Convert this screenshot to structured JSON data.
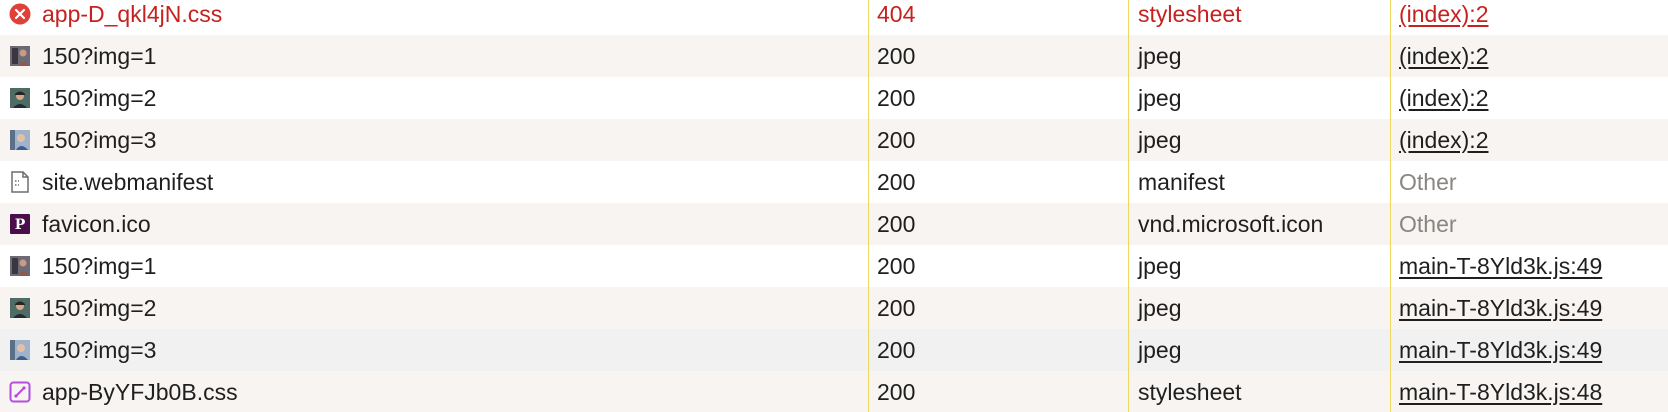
{
  "colors": {
    "error": "#c5221f",
    "divider": "#f0d860",
    "row_alt": "#f7f4f2",
    "row_hover": "#f1f1f2",
    "muted": "#8a8580",
    "css_icon": "#b44ce0",
    "favicon_bg": "#4a0f4a"
  },
  "rows": [
    {
      "icon": "error-circle-icon",
      "name": "app-D_qkl4jN.css",
      "status": "404",
      "type": "stylesheet",
      "initiator": "(index):2",
      "initiator_link": true,
      "error": true
    },
    {
      "icon": "image-thumbnail-icon",
      "name": "150?img=1",
      "status": "200",
      "type": "jpeg",
      "initiator": "(index):2",
      "initiator_link": true
    },
    {
      "icon": "image-thumbnail-icon",
      "name": "150?img=2",
      "status": "200",
      "type": "jpeg",
      "initiator": "(index):2",
      "initiator_link": true
    },
    {
      "icon": "image-thumbnail-icon",
      "name": "150?img=3",
      "status": "200",
      "type": "jpeg",
      "initiator": "(index):2",
      "initiator_link": true
    },
    {
      "icon": "document-icon",
      "name": "site.webmanifest",
      "status": "200",
      "type": "manifest",
      "initiator": "Other",
      "initiator_link": false
    },
    {
      "icon": "favicon-p-icon",
      "favicon_letter": "P",
      "name": "favicon.ico",
      "status": "200",
      "type": "vnd.microsoft.icon",
      "initiator": "Other",
      "initiator_link": false
    },
    {
      "icon": "image-thumbnail-icon",
      "name": "150?img=1",
      "status": "200",
      "type": "jpeg",
      "initiator": "main-T-8Yld3k.js:49",
      "initiator_link": true
    },
    {
      "icon": "image-thumbnail-icon",
      "name": "150?img=2",
      "status": "200",
      "type": "jpeg",
      "initiator": "main-T-8Yld3k.js:49",
      "initiator_link": true
    },
    {
      "icon": "image-thumbnail-icon",
      "name": "150?img=3",
      "status": "200",
      "type": "jpeg",
      "initiator": "main-T-8Yld3k.js:49",
      "initiator_link": true
    },
    {
      "icon": "stylesheet-icon",
      "name": "app-ByYFJb0B.css",
      "status": "200",
      "type": "stylesheet",
      "initiator": "main-T-8Yld3k.js:48",
      "initiator_link": true
    }
  ]
}
